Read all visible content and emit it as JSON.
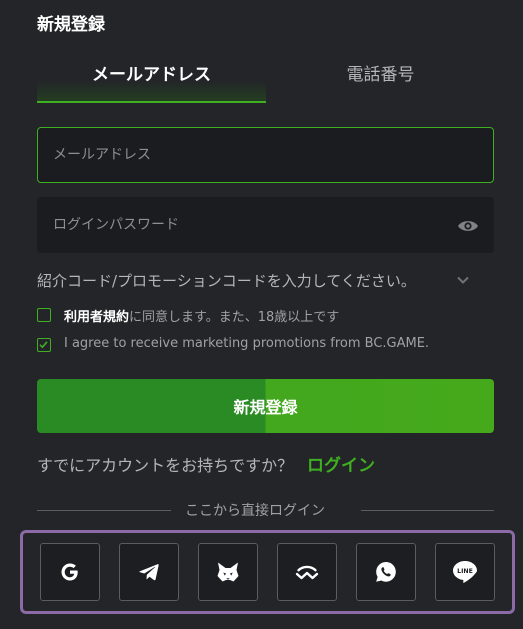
{
  "header": {
    "title": "新規登録"
  },
  "tabs": [
    {
      "label": "メールアドレス"
    },
    {
      "label": "電話番号"
    }
  ],
  "form": {
    "email_placeholder": "メールアドレス",
    "password_placeholder": "ログインパスワード",
    "promo_label": "紹介コード/プロモーションコードを入力してください。"
  },
  "terms": {
    "link": "利用者規約",
    "text": "に同意します。また、18歳以上です",
    "checked": false
  },
  "marketing": {
    "text": "I agree to receive marketing promotions from BC.GAME.",
    "checked": true
  },
  "submit_label": "新規登録",
  "login_prompt": {
    "text": "すでにアカウントをお持ちですか？",
    "link": "ログイン"
  },
  "divider_text": "ここから直接ログイン",
  "social": [
    {
      "icon": "google-icon"
    },
    {
      "icon": "telegram-icon"
    },
    {
      "icon": "metamask-icon"
    },
    {
      "icon": "walletconnect-icon"
    },
    {
      "icon": "whatsapp-icon"
    },
    {
      "icon": "line-icon",
      "label": "LINE"
    }
  ],
  "colors": {
    "accent": "#3fb022",
    "background": "#232528",
    "field": "#1b1c1f",
    "highlight_frame": "#8b6aa6"
  }
}
